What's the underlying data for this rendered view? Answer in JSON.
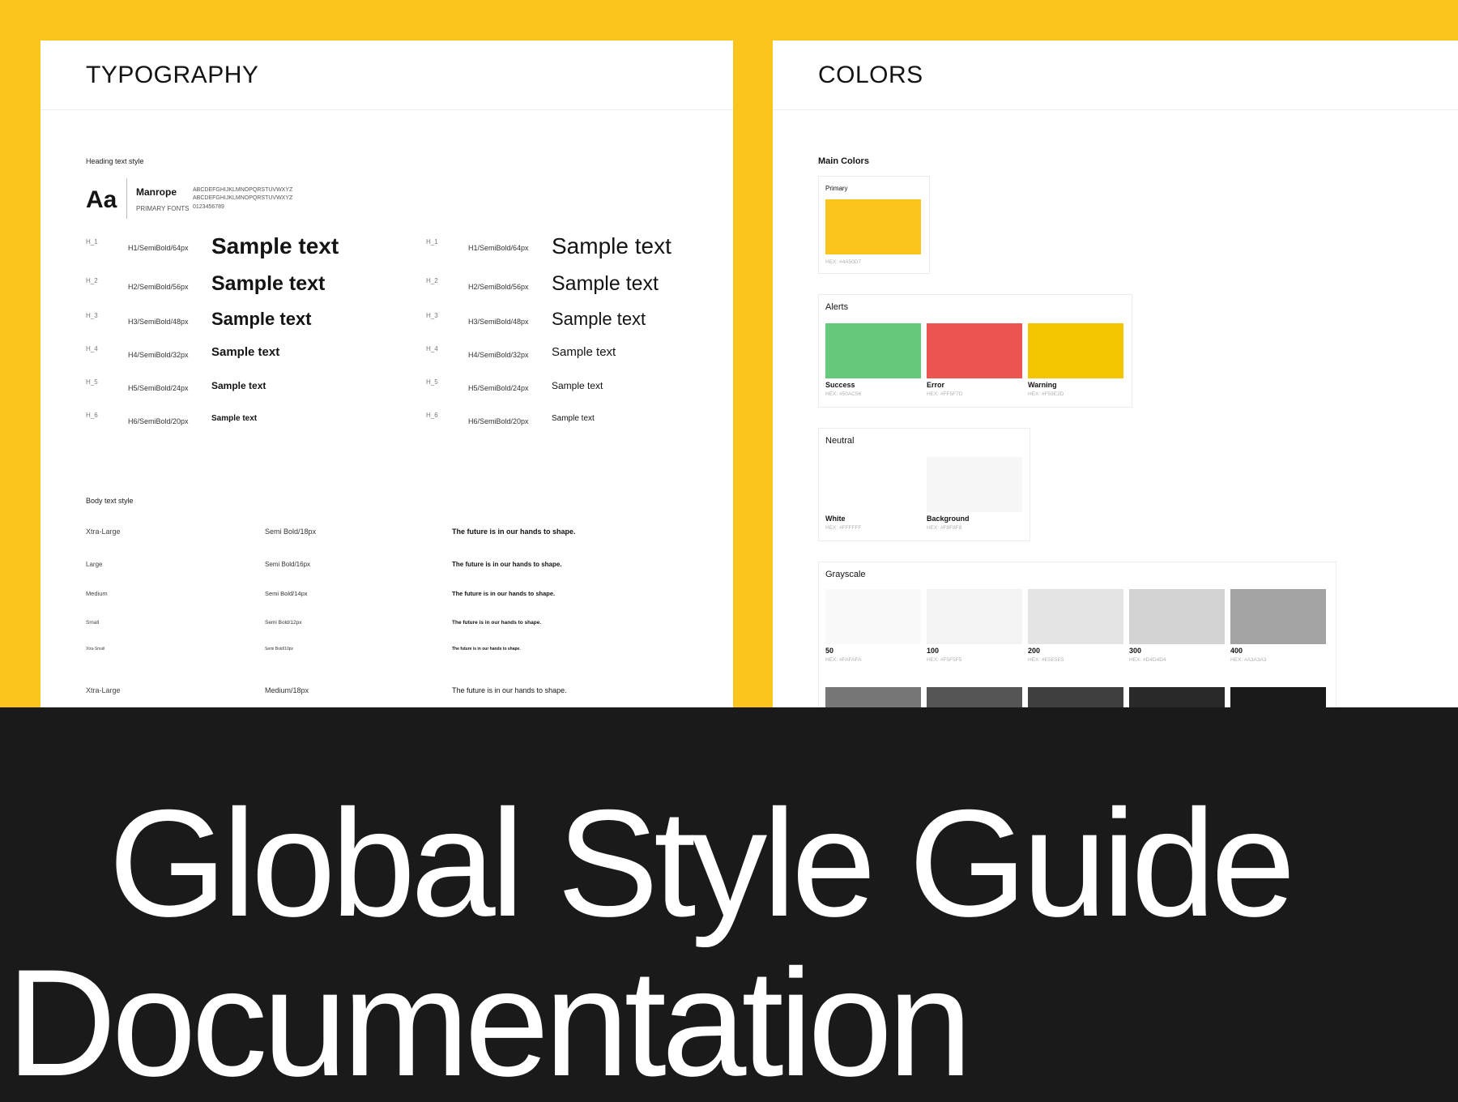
{
  "typography": {
    "title": "TYPOGRAPHY",
    "heading_section_label": "Heading text style",
    "font": {
      "preview": "Aa",
      "name": "Manrope",
      "role": "PRIMARY FONTS",
      "upper": "ABCDEFGHIJKLMNOPQRSTUVWXYZ",
      "lower": "ABCDEFGHIJKLMNOPQRSTUVWXYZ",
      "digits": "0123456789"
    },
    "headings_left": [
      {
        "tag": "H_1",
        "spec": "H1/SemiBold/64px",
        "sample": "Sample text"
      },
      {
        "tag": "H_2",
        "spec": "H2/SemiBold/56px",
        "sample": "Sample text"
      },
      {
        "tag": "H_3",
        "spec": "H3/SemiBold/48px",
        "sample": "Sample text"
      },
      {
        "tag": "H_4",
        "spec": "H4/SemiBold/32px",
        "sample": "Sample text"
      },
      {
        "tag": "H_5",
        "spec": "H5/SemiBold/24px",
        "sample": "Sample text"
      },
      {
        "tag": "H_6",
        "spec": "H6/SemiBold/20px",
        "sample": "Sample text"
      }
    ],
    "headings_right": [
      {
        "tag": "H_1",
        "spec": "H1/SemiBold/64px",
        "sample": "Sample text"
      },
      {
        "tag": "H_2",
        "spec": "H2/SemiBold/56px",
        "sample": "Sample text"
      },
      {
        "tag": "H_3",
        "spec": "H3/SemiBold/48px",
        "sample": "Sample text"
      },
      {
        "tag": "H_4",
        "spec": "H4/SemiBold/32px",
        "sample": "Sample text"
      },
      {
        "tag": "H_5",
        "spec": "H5/SemiBold/24px",
        "sample": "Sample text"
      },
      {
        "tag": "H_6",
        "spec": "H6/SemiBold/20px",
        "sample": "Sample text"
      }
    ],
    "body_section_label": "Body text style",
    "body_rows": [
      {
        "size": "Xtra-Large",
        "spec": "Semi Bold/18px",
        "sample": "The future is in our hands to shape."
      },
      {
        "size": "Large",
        "spec": "Semi Bold/16px",
        "sample": "The future is in our hands to shape."
      },
      {
        "size": "Medium",
        "spec": "Semi Bold/14px",
        "sample": "The future is in our hands to shape."
      },
      {
        "size": "Small",
        "spec": "Semi Bold/12px",
        "sample": "The future is in our hands to shape."
      },
      {
        "size": "Xtra-Small",
        "spec": "Semi Bold/10px",
        "sample": "The future is in our hands to shape."
      },
      {
        "size": "Xtra-Large",
        "spec": "Medium/18px",
        "sample": "The future is in our hands to shape."
      }
    ]
  },
  "colors": {
    "title": "COLORS",
    "main_label": "Main Colors",
    "primary": {
      "name": "Primary",
      "hex": "HEX: #4A50D7",
      "color": "#FCC51D"
    },
    "alerts": {
      "title": "Alerts",
      "items": [
        {
          "name": "Success",
          "hex": "HEX: #50AC56",
          "color": "#67C97C"
        },
        {
          "name": "Error",
          "hex": "HEX: #FF5F7D",
          "color": "#EC5550"
        },
        {
          "name": "Warning",
          "hex": "HEX: #F59E2D",
          "color": "#F2C500"
        }
      ]
    },
    "neutral": {
      "title": "Neutral",
      "items": [
        {
          "name": "White",
          "hex": "HEX: #FFFFFF",
          "color": "#FFFFFF"
        },
        {
          "name": "Background",
          "hex": "HEX: #F8F8F8",
          "color": "#F7F7F7"
        }
      ]
    },
    "grayscale": {
      "title": "Grayscale",
      "items": [
        {
          "name": "50",
          "hex": "HEX: #FAFAFA",
          "color": "#F9F9F9"
        },
        {
          "name": "100",
          "hex": "HEX: #F5F5F5",
          "color": "#F3F3F3"
        },
        {
          "name": "200",
          "hex": "HEX: #E5E5E5",
          "color": "#E4E4E4"
        },
        {
          "name": "300",
          "hex": "HEX: #D4D4D4",
          "color": "#D3D3D3"
        },
        {
          "name": "400",
          "hex": "HEX: #A3A3A3",
          "color": "#A4A4A4"
        }
      ],
      "row2_colors": [
        "#777777",
        "#555555",
        "#404040",
        "#292929",
        "#1a1a1a"
      ]
    }
  },
  "banner": {
    "line1": "Global Style Guide",
    "line2": "Documentation"
  }
}
